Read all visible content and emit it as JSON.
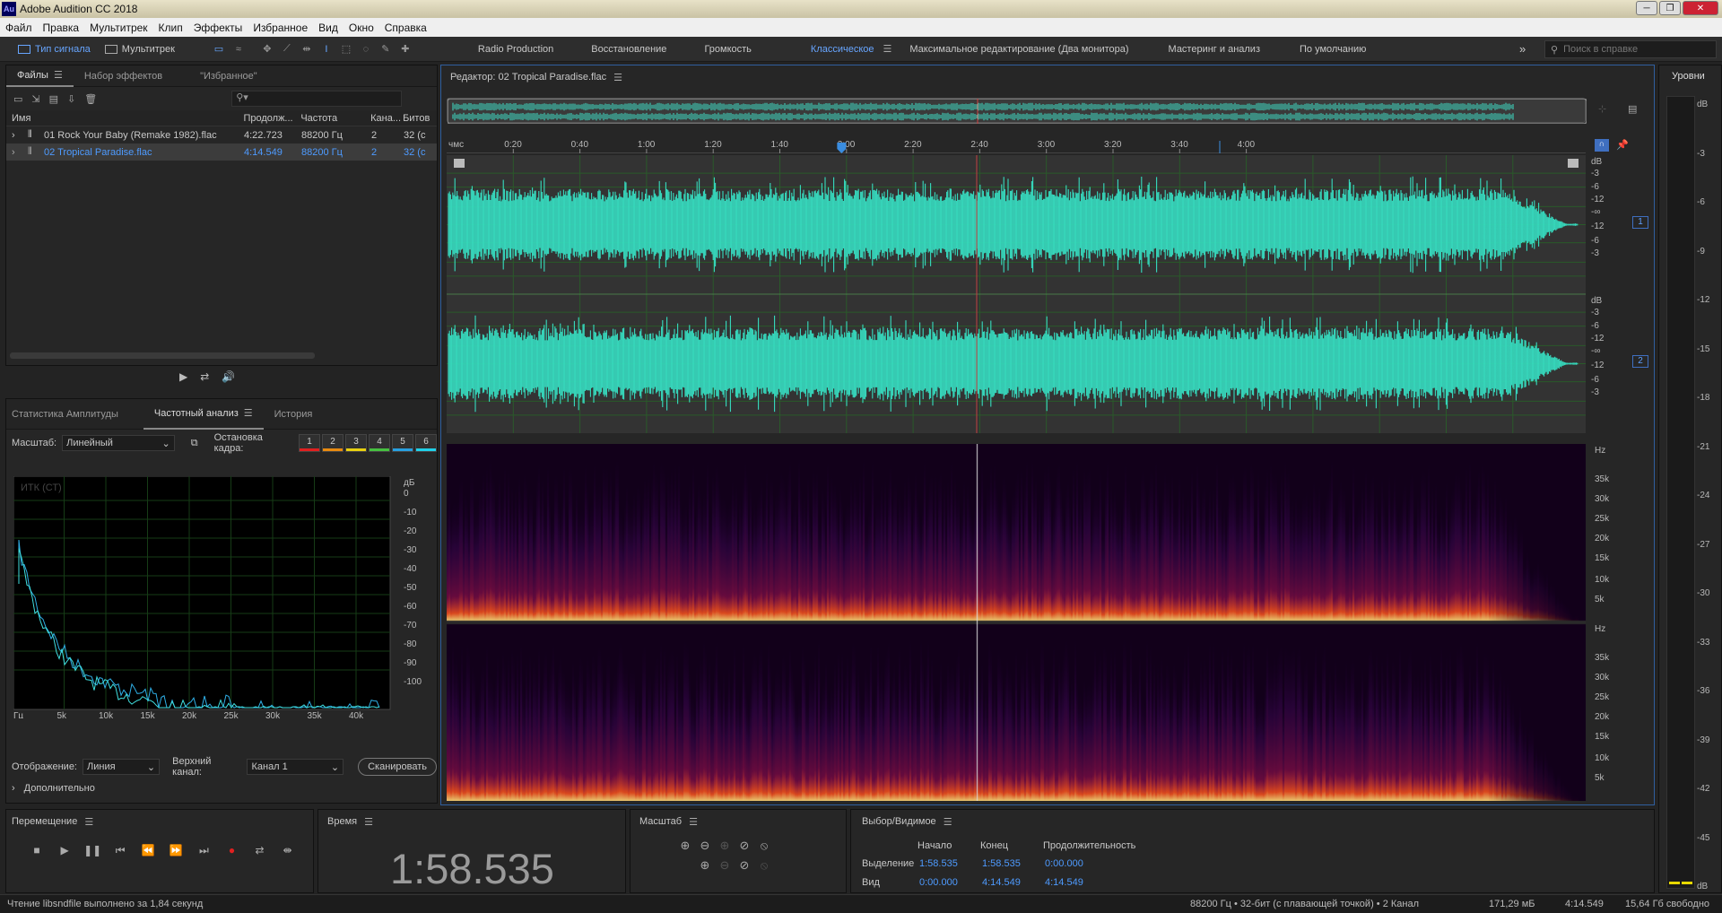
{
  "window": {
    "title": "Adobe Audition CC 2018",
    "logo": "Au"
  },
  "menu": [
    "Файл",
    "Правка",
    "Мультитрек",
    "Клип",
    "Эффекты",
    "Избранное",
    "Вид",
    "Окно",
    "Справка"
  ],
  "toolbar": {
    "waveform_label": "Тип сигнала",
    "multitrack_label": "Мультитрек",
    "workspaces": [
      "Radio Production",
      "Восстановление",
      "Громкость",
      "Классическое",
      "Максимальное редактирование (Два монитора)",
      "Мастеринг и анализ",
      "По умолчанию"
    ],
    "active_workspace": "Классическое",
    "search_placeholder": "Поиск в справке"
  },
  "files": {
    "tabs": [
      "Файлы",
      "Набор эффектов",
      "\"Избранное\""
    ],
    "columns": [
      "Имя",
      "Продолж...",
      "Частота",
      "Кана...",
      "Битов"
    ],
    "rows": [
      {
        "name": "01 Rock Your Baby (Remake 1982).flac",
        "duration": "4:22.723",
        "rate": "88200 Гц",
        "channels": "2",
        "bits": "32 (с"
      },
      {
        "name": "02 Tropical Paradise.flac",
        "duration": "4:14.549",
        "rate": "88200 Гц",
        "channels": "2",
        "bits": "32 (с"
      }
    ]
  },
  "analysis": {
    "tabs": [
      "Статистика Амплитуды",
      "Частотный анализ",
      "История"
    ],
    "scale_label": "Масштаб:",
    "scale_value": "Линейный",
    "freeze_label": "Остановка кадра:",
    "freeze_slots": [
      "1",
      "2",
      "3",
      "4",
      "5",
      "6"
    ],
    "freeze_colors": [
      "#e02020",
      "#e88a10",
      "#e8d010",
      "#46c040",
      "#28a0e0",
      "#20d0e8"
    ],
    "watermark": "ИТК (СТ)",
    "db_ticks": [
      "дБ",
      "0",
      "-10",
      "-20",
      "-30",
      "-40",
      "-50",
      "-60",
      "-70",
      "-80",
      "-90",
      "-100"
    ],
    "hz_ticks": [
      "Гц",
      "5k",
      "10k",
      "15k",
      "20k",
      "25k",
      "30k",
      "35k",
      "40k"
    ],
    "display_label": "Отображение:",
    "display_value": "Линия",
    "channel_label": "Верхний канал:",
    "channel_value": "Канал 1",
    "scan_label": "Сканировать",
    "advanced_label": "Дополнительно"
  },
  "editor": {
    "title": "Редактор: 02 Tropical Paradise.flac",
    "ruler": [
      "чмс",
      "0:20",
      "0:40",
      "1:00",
      "1:20",
      "1:40",
      "2:00",
      "2:20",
      "2:40",
      "3:00",
      "3:20",
      "3:40",
      "4:00"
    ],
    "db_scale": [
      "dB",
      "-3",
      "-6",
      "-12",
      "-∞",
      "-12",
      "-6",
      "-3"
    ],
    "channels": [
      "1",
      "2"
    ],
    "hz_scale": [
      "Hz",
      "35k",
      "30k",
      "25k",
      "20k",
      "15k",
      "10k",
      "5k"
    ],
    "playhead_seconds": 118.535,
    "duration_seconds": 254.549
  },
  "levels": {
    "title": "Уровни",
    "ticks": [
      "dB",
      "-3",
      "-6",
      "-9",
      "-12",
      "-15",
      "-18",
      "-21",
      "-24",
      "-27",
      "-30",
      "-33",
      "-36",
      "-39",
      "-42",
      "-45",
      "dB"
    ]
  },
  "transport": {
    "title": "Перемещение"
  },
  "time": {
    "title": "Время",
    "value": "1:58.535"
  },
  "zoom": {
    "title": "Масштаб"
  },
  "selection": {
    "title": "Выбор/Видимое",
    "headers": [
      "Начало",
      "Конец",
      "Продолжительность"
    ],
    "rows": [
      {
        "label": "Выделение",
        "start": "1:58.535",
        "end": "1:58.535",
        "duration": "0:00.000"
      },
      {
        "label": "Вид",
        "start": "0:00.000",
        "end": "4:14.549",
        "duration": "4:14.549"
      }
    ]
  },
  "status": {
    "left": "Чтение libsndfile выполнено за 1,84 секунд",
    "format": "88200 Гц • 32-бит (с плавающей точкой) • 2 Канал",
    "size": "171,29 мБ",
    "duration": "4:14.549",
    "free": "15,64 Гб свободно"
  }
}
